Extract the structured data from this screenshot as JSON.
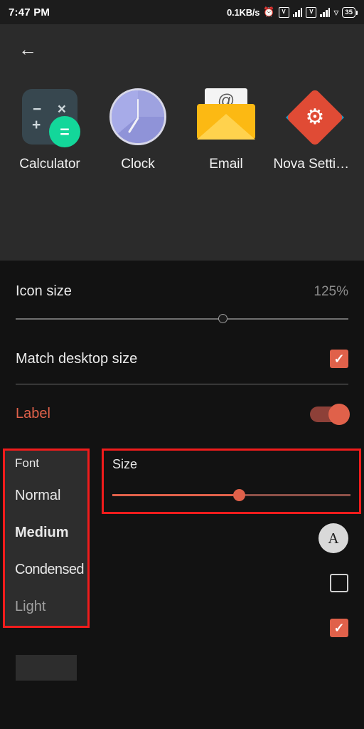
{
  "status_bar": {
    "time": "7:47 PM",
    "net_speed": "0.1KB/s",
    "alarm_icon": "alarm-icon",
    "sim1_icon": "volte-icon",
    "sim1_signal_icon": "signal-bars-icon",
    "sim2_icon": "volte-icon",
    "sim2_signal_icon": "signal-bars-icon",
    "wifi_icon": "wifi-icon",
    "battery_level": "35"
  },
  "preview": {
    "back_icon": "back-arrow-icon",
    "apps": [
      {
        "label": "Calculator",
        "icon": "calculator-icon"
      },
      {
        "label": "Clock",
        "icon": "clock-icon"
      },
      {
        "label": "Email",
        "icon": "email-icon"
      },
      {
        "label": "Nova Settin…",
        "icon": "nova-settings-icon"
      }
    ]
  },
  "settings": {
    "icon_size": {
      "label": "Icon size",
      "value": "125%"
    },
    "match_desktop": {
      "label": "Match desktop size",
      "checked_mark": "✓"
    },
    "label_toggle": {
      "label": "Label",
      "state": "on"
    }
  },
  "font_menu": {
    "header": "Font",
    "items": [
      {
        "label": "Normal"
      },
      {
        "label": "Medium"
      },
      {
        "label": "Condensed"
      },
      {
        "label": "Light"
      }
    ]
  },
  "size_control": {
    "label": "Size"
  },
  "right_controls": {
    "style_button": "A",
    "shadow_checkbox": "",
    "single_line_checkbox": "✓"
  },
  "colors": {
    "accent": "#e0614a",
    "highlight_border": "#f01c1c",
    "background": "#121212",
    "preview_bg": "#2b2b2b"
  }
}
